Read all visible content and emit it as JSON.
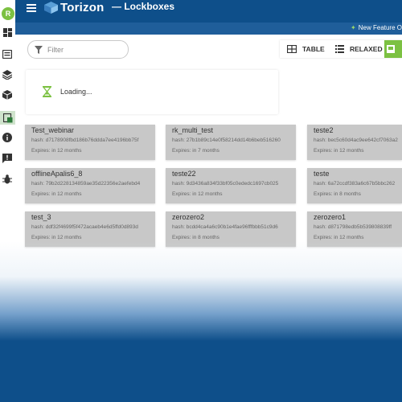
{
  "sidebar": {
    "avatar_initial": "R",
    "items": [
      {
        "icon": "dashboard-icon"
      },
      {
        "icon": "devices-icon"
      },
      {
        "icon": "layers-icon"
      },
      {
        "icon": "packages-icon"
      },
      {
        "icon": "lockbox-icon",
        "active": true
      },
      {
        "icon": "info-icon"
      },
      {
        "icon": "feedback-icon"
      },
      {
        "icon": "bug-icon"
      }
    ]
  },
  "header": {
    "logo_text": "Torizon",
    "page_title": "— Lockboxes"
  },
  "banner": {
    "text": "New Feature O"
  },
  "filter": {
    "placeholder": "Filter"
  },
  "view_toggle": {
    "table_label": "TABLE",
    "relaxed_label": "RELAXED"
  },
  "loading": {
    "text": "Loading..."
  },
  "lockboxes": [
    {
      "name": "Test_webinar",
      "hash": "hash: d7178908fbd186b76ddda7ee4196bb75f",
      "expires": "Expires: in 12 months"
    },
    {
      "name": "rk_multi_test",
      "hash": "hash: 27b1b89c14e0f58214dd14b6beb516260",
      "expires": "Expires: in 7 months"
    },
    {
      "name": "teste2",
      "hash": "hash: bec5c60d4ac9ee642cf7063a2",
      "expires": "Expires: in 12 months"
    },
    {
      "name": "offlineApalis6_8",
      "hash": "hash: 79b2d228134859ae35d22356e2aefebd4",
      "expires": "Expires: in 12 months"
    },
    {
      "name": "teste22",
      "hash": "hash: 9d3436a834f33bf05c0ededc1697cb025",
      "expires": "Expires: in 12 months"
    },
    {
      "name": "teste",
      "hash": "hash: 6a72ccdf383a6c67b5bbc262",
      "expires": "Expires: in 8 months"
    },
    {
      "name": "test_3",
      "hash": "hash: ddf32f4699f5f472acaeb4e6d5ffd0d893d",
      "expires": "Expires: in 12 months"
    },
    {
      "name": "zerozero2",
      "hash": "hash: bcdd4ca4a6c90b1e4fae96fffbbb51c9d6",
      "expires": "Expires: in 8 months"
    },
    {
      "name": "zerozero1",
      "hash": "hash: d871798edb5b539808839ff",
      "expires": "Expires: in 12 months"
    }
  ],
  "colors": {
    "header_bg": "#0e4f8a",
    "strip_bg": "#1f5e9a",
    "accent": "#7cc142",
    "card_bg": "#c8c8c8"
  }
}
